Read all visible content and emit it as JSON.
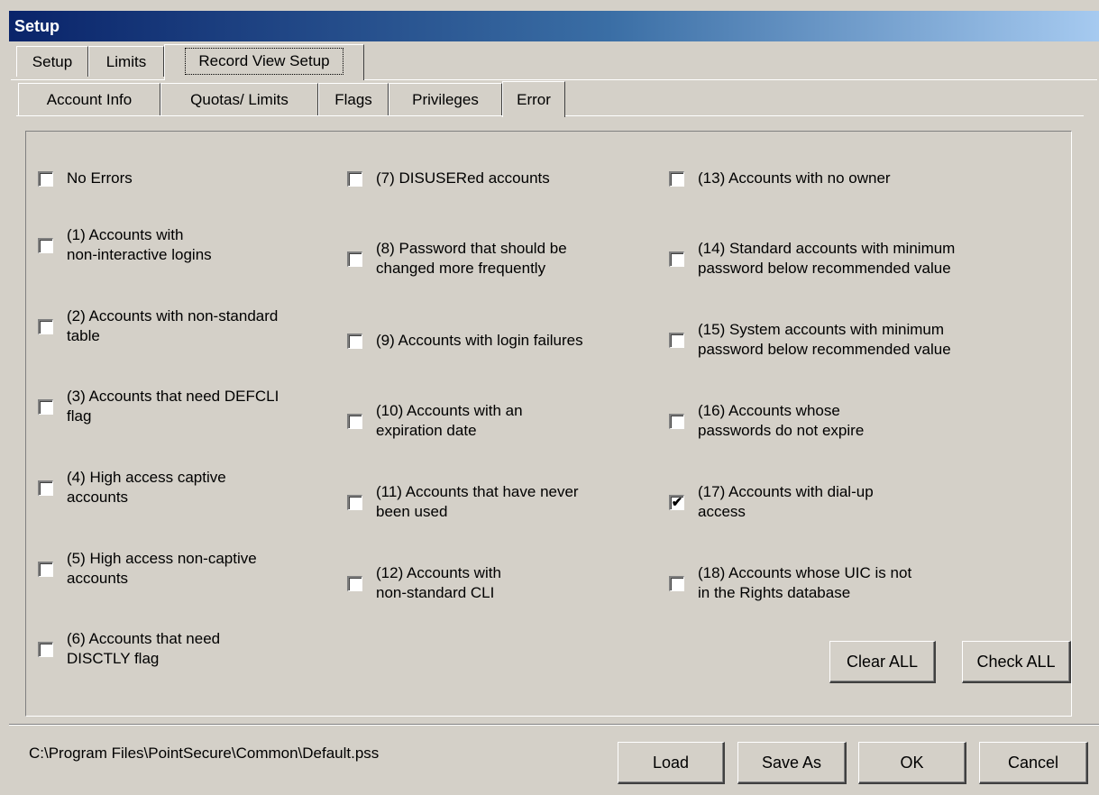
{
  "window": {
    "title": "Setup"
  },
  "top_tabs": [
    {
      "label": "Setup"
    },
    {
      "label": "Limits"
    },
    {
      "label": "Record View Setup"
    }
  ],
  "sub_tabs": [
    {
      "label": "Account Info"
    },
    {
      "label": "Quotas/ Limits"
    },
    {
      "label": "Flags"
    },
    {
      "label": "Privileges"
    },
    {
      "label": "Error"
    }
  ],
  "columns": [
    [
      {
        "label": "No Errors",
        "checked": false
      },
      {
        "label": "(1) Accounts with\nnon-interactive logins",
        "checked": false
      },
      {
        "label": "(2) Accounts with non-standard\ntable",
        "checked": false
      },
      {
        "label": "(3) Accounts that need DEFCLI\nflag",
        "checked": false
      },
      {
        "label": "(4) High access captive\naccounts",
        "checked": false
      },
      {
        "label": "(5) High access non-captive\naccounts",
        "checked": false
      },
      {
        "label": "(6) Accounts that need\nDISCTLY flag",
        "checked": false
      }
    ],
    [
      {
        "label": "(7) DISUSERed accounts",
        "checked": false
      },
      {
        "label": "(8) Password that should be\nchanged more frequently",
        "checked": false
      },
      {
        "label": "(9) Accounts with login failures",
        "checked": false
      },
      {
        "label": "(10) Accounts with an\nexpiration date",
        "checked": false
      },
      {
        "label": "(11) Accounts that have never\nbeen used",
        "checked": false
      },
      {
        "label": "(12) Accounts with\nnon-standard CLI",
        "checked": false
      }
    ],
    [
      {
        "label": "(13) Accounts with no owner",
        "checked": false
      },
      {
        "label": "(14) Standard accounts with minimum\npassword below recommended value",
        "checked": false
      },
      {
        "label": "(15) System accounts with minimum\npassword below recommended value",
        "checked": false
      },
      {
        "label": "(16) Accounts whose\npasswords do not expire",
        "checked": false
      },
      {
        "label": "(17) Accounts with dial-up\naccess",
        "checked": true
      },
      {
        "label": "(18) Accounts whose UIC is not\nin the Rights database",
        "checked": false
      }
    ]
  ],
  "panel_buttons": {
    "clear_all": "Clear ALL",
    "check_all": "Check ALL"
  },
  "footer": {
    "file_path": "C:\\Program Files\\PointSecure\\Common\\Default.pss",
    "load": "Load",
    "save_as": "Save As",
    "ok": "OK",
    "cancel": "Cancel"
  },
  "check_glyph": "✔"
}
